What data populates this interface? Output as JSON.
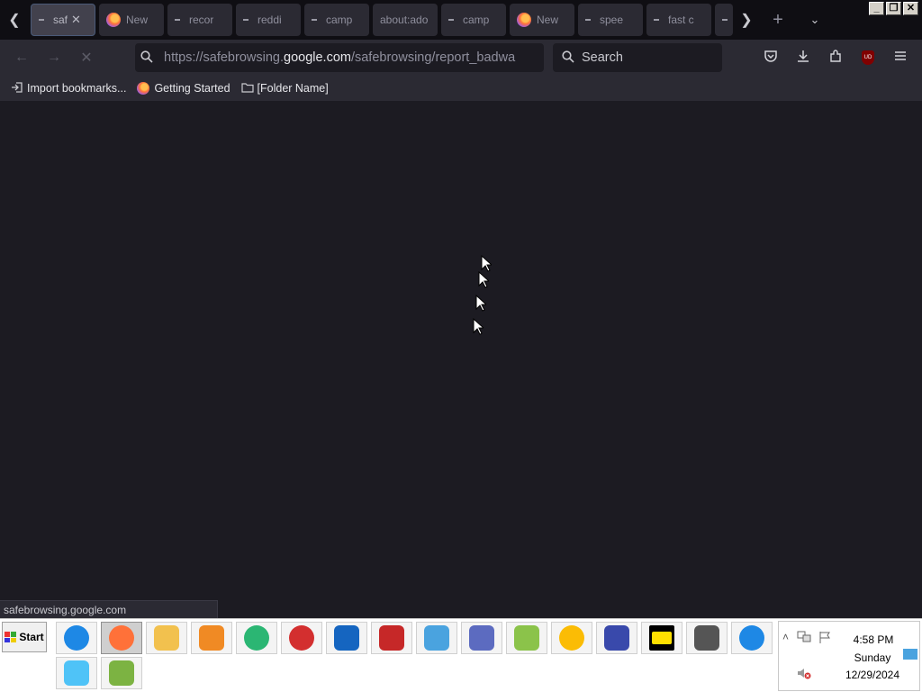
{
  "tabs": [
    {
      "label": "saf",
      "type": "dot",
      "active": true,
      "closable": true
    },
    {
      "label": "New",
      "type": "firefox"
    },
    {
      "label": "recor",
      "type": "dot"
    },
    {
      "label": "reddi",
      "type": "dot"
    },
    {
      "label": "camp",
      "type": "dot"
    },
    {
      "label": "about:ado",
      "type": "none"
    },
    {
      "label": "camp",
      "type": "dot"
    },
    {
      "label": "New",
      "type": "firefox"
    },
    {
      "label": "spee",
      "type": "dot"
    },
    {
      "label": "fast c",
      "type": "dot"
    },
    {
      "label": "",
      "type": "dot"
    }
  ],
  "tab_close_glyph": "✕",
  "nav": {
    "back_icon": "←",
    "forward_icon": "→",
    "stop_icon": "✕"
  },
  "url": {
    "prefix": "https://safebrowsing.",
    "domain": "google.com",
    "path": "/safebrowsing/report_badwa"
  },
  "search": {
    "placeholder": "Search"
  },
  "toolbar": {
    "ublock_label": "UD"
  },
  "bookmarks": [
    {
      "label": "Import bookmarks...",
      "icon": "import-icon"
    },
    {
      "label": "Getting Started",
      "icon": "firefox-icon"
    },
    {
      "label": "[Folder Name]",
      "icon": "folder-icon"
    }
  ],
  "status": {
    "text": "safebrowsing.google.com"
  },
  "taskbar": {
    "start_label": "Start",
    "apps": [
      {
        "name": "internet-explorer",
        "color": "#1e88e5"
      },
      {
        "name": "firefox",
        "color": "#ff7139",
        "active": true
      },
      {
        "name": "file-explorer",
        "color": "#f2c14e"
      },
      {
        "name": "media-player",
        "color": "#f08a24"
      },
      {
        "name": "edge-legacy",
        "color": "#2bb673"
      },
      {
        "name": "antivirus",
        "color": "#d32f2f"
      },
      {
        "name": "vpn-shield",
        "color": "#1565c0"
      },
      {
        "name": "screen-recorder",
        "color": "#c62828"
      },
      {
        "name": "control-panel",
        "color": "#4aa3df"
      },
      {
        "name": "bird-app",
        "color": "#5c6bc0"
      },
      {
        "name": "paint",
        "color": "#8bc34a"
      },
      {
        "name": "chrome",
        "color": "#fbbc05"
      },
      {
        "name": "infinity-app",
        "color": "#3949ab"
      },
      {
        "name": "best-buy",
        "color": "#ffe000"
      },
      {
        "name": "blackberry",
        "color": "#555555"
      },
      {
        "name": "edge",
        "color": "#1e88e5"
      },
      {
        "name": "recycle-bin",
        "color": "#4fc3f7"
      },
      {
        "name": "3d-box",
        "color": "#7cb342"
      }
    ]
  },
  "tray": {
    "time": "4:58 PM",
    "day": "Sunday",
    "date": "12/29/2024"
  }
}
